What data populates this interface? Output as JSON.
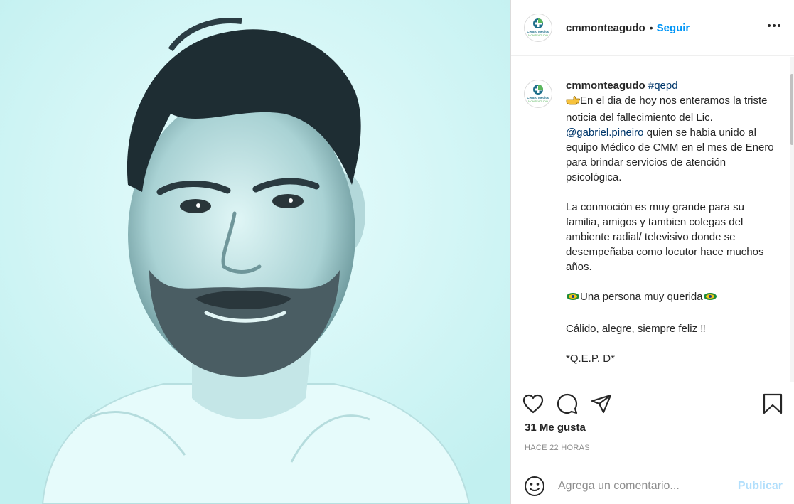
{
  "post": {
    "image_description_icon": "portrait-photo",
    "background_color": "#c9f3f3"
  },
  "header": {
    "username": "cmmonteagudo",
    "dot": "•",
    "follow_label": "Seguir",
    "more_icon": "more-horizontal-icon"
  },
  "logo": {
    "line1": "Centro Médico",
    "line2": "MONTEAGUDO"
  },
  "caption": {
    "username": "cmmonteagudo",
    "hashtag": "#qepd",
    "line1": "En el dia de hoy nos enteramos la triste noticia del fallecimiento del Lic.",
    "mention": "@gabriel.pineiro",
    "line1b": "quien se habia unido al equipo Médico de CMM en el mes de Enero para brindar servicios de atención psicológica.",
    "para2": "La conmoción es muy grande para su familia, amigos y tambien colegas del ambiente radial/ televisivo donde se desempeñaba como locutor hace muchos años.",
    "para3": "Una persona muy querida",
    "para4": "Cálido, alegre, siempre feliz ‼",
    "para5": "*Q.E.P. D*"
  },
  "actions": {
    "like_icon": "heart-icon",
    "comment_icon": "comment-icon",
    "share_icon": "share-icon",
    "save_icon": "bookmark-icon"
  },
  "likes": {
    "text": "31 Me gusta"
  },
  "timestamp": "HACE 22 HORAS",
  "comment_box": {
    "emoji_icon": "smiley-icon",
    "placeholder": "Agrega un comentario...",
    "publish_label": "Publicar"
  },
  "colors": {
    "accent": "#0095f6",
    "publish_disabled": "#b2dffc",
    "link": "#00376b"
  }
}
